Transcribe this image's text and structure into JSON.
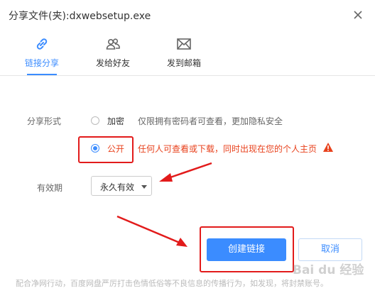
{
  "window": {
    "title": "分享文件(夹):dxwebsetup.exe"
  },
  "tabs": [
    {
      "label": "链接分享",
      "icon": "link-icon",
      "active": true
    },
    {
      "label": "发给好友",
      "icon": "friends-icon",
      "active": false
    },
    {
      "label": "发到邮箱",
      "icon": "mail-icon",
      "active": false
    }
  ],
  "share_form": {
    "label": "分享形式",
    "options": [
      {
        "label": "加密",
        "description": "仅限拥有密码者可查看，更加隐私安全",
        "checked": false
      },
      {
        "label": "公开",
        "description": "任何人可查看或下载，同时出现在您的个人主页",
        "checked": true
      }
    ]
  },
  "validity": {
    "label": "有效期",
    "selected": "永久有效"
  },
  "buttons": {
    "create": "创建链接",
    "cancel": "取消"
  },
  "footer": {
    "notice": "配合净网行动，百度网盘严厉打击色情低俗等不良信息的传播行为，如发现，将封禁账号。"
  },
  "watermark": {
    "text": "Bai du 经验"
  },
  "colors": {
    "accent": "#3b8cff",
    "annotation_red": "#e21b1b",
    "warning_text": "#e8411c"
  }
}
